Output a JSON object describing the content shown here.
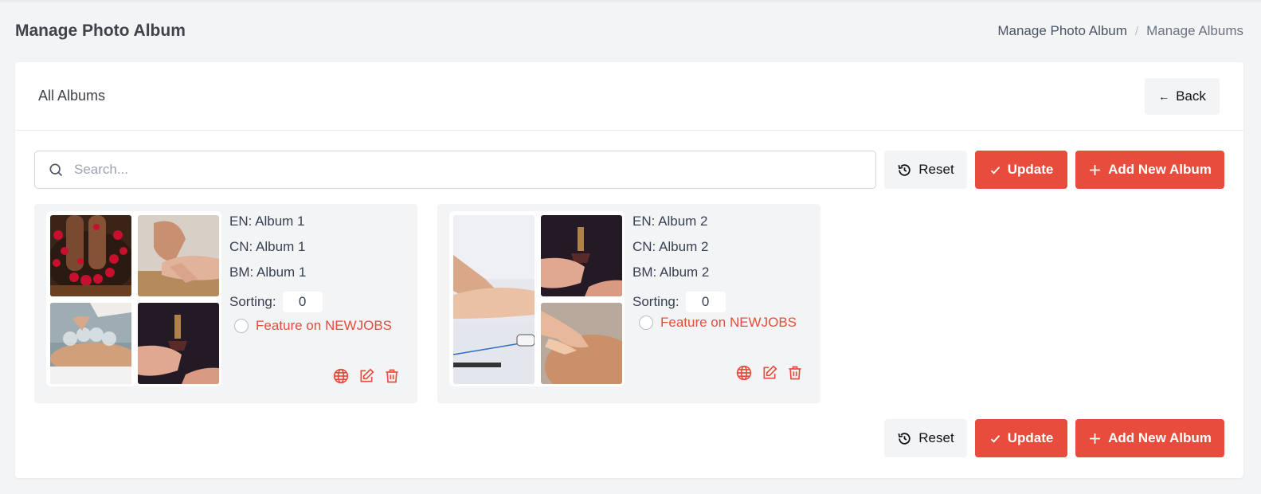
{
  "header": {
    "title": "Manage Photo Album",
    "breadcrumb": [
      "Manage Photo Album",
      "Manage Albums"
    ],
    "separator": "/"
  },
  "card": {
    "title": "All Albums",
    "back_label": "Back"
  },
  "toolbar": {
    "search_placeholder": "Search...",
    "search_value": "",
    "reset_label": "Reset",
    "update_label": "Update",
    "add_label": "Add New Album"
  },
  "albums": [
    {
      "en": "EN: Album 1",
      "cn": "CN: Album 1",
      "bm": "BM: Album 1",
      "sorting_label": "Sorting:",
      "sorting_value": "0",
      "feature_label": "Feature on NEWJOBS",
      "featured": false,
      "images": [
        "foot-bath-rose-petals",
        "acupuncture-needle-hand",
        "cupping-therapy-back",
        "moxibustion-stick"
      ]
    },
    {
      "en": "EN: Album 2",
      "cn": "CN: Album 2",
      "bm": "BM: Album 2",
      "sorting_label": "Sorting:",
      "sorting_value": "0",
      "feature_label": "Feature on NEWJOBS",
      "featured": false,
      "images": [
        "pulse-diagnosis-wrist",
        "moxibustion-stick",
        "back-massage"
      ]
    }
  ],
  "colors": {
    "accent": "#e74c3c",
    "background": "#f3f4f6"
  }
}
